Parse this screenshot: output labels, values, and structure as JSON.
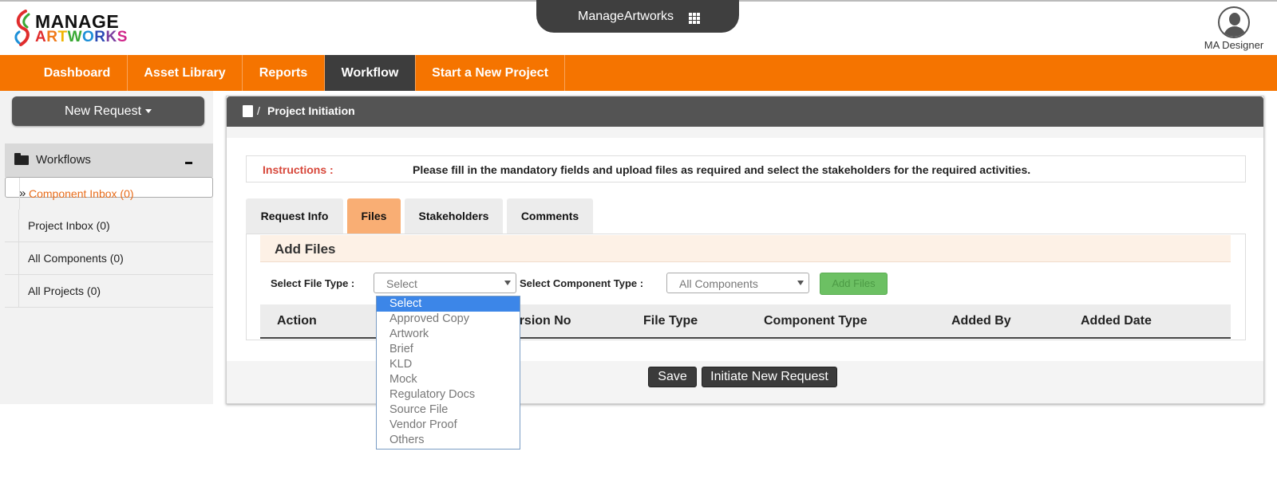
{
  "logo": {
    "line1": "MANAGE",
    "line2_letters": [
      "A",
      "R",
      "T",
      "W",
      "O",
      "R",
      "K",
      "S"
    ],
    "line2_colors": [
      "#e02d2d",
      "#f07a1a",
      "#f0b400",
      "#39a935",
      "#1c8fd8",
      "#2b4bb5",
      "#7b3fa0",
      "#d0288b"
    ]
  },
  "appbar": {
    "title": "ManageArtworks",
    "icon": "apps-grid-icon"
  },
  "user": {
    "name": "MA Designer",
    "icon": "user-avatar-icon"
  },
  "nav": {
    "items": [
      "Dashboard",
      "Asset Library",
      "Reports",
      "Workflow",
      "Start a New Project"
    ],
    "active": "Workflow"
  },
  "sidebar": {
    "new_request": "New Request",
    "workflows_label": "Workflows",
    "collapse_symbol": "-",
    "items": [
      {
        "label": "Component Inbox (0)",
        "selected": true,
        "marker": "»"
      },
      {
        "label": "Project Inbox (0)",
        "selected": false
      },
      {
        "label": "All Components (0)",
        "selected": false
      },
      {
        "label": "All Projects (0)",
        "selected": false
      }
    ]
  },
  "panel": {
    "breadcrumb_sep": "/",
    "title": "Project Initiation",
    "instructions_label": "Instructions :",
    "instructions_text": "Please fill in the mandatory fields and upload files as required and select the stakeholders for the required activities.",
    "tabs": [
      "Request Info",
      "Files",
      "Stakeholders",
      "Comments"
    ],
    "active_tab": "Files",
    "add_files_title": "Add Files",
    "file_type_label": "Select File Type :",
    "file_type_value": "Select",
    "component_type_label": "Select Component Type :",
    "component_type_value": "All Components",
    "add_files_button": "Add Files",
    "columns": [
      "Action",
      "Version No",
      "File Type",
      "Component Type",
      "Added By",
      "Added Date"
    ],
    "save_button": "Save",
    "initiate_button": "Initiate New Request"
  },
  "file_type_options": [
    "Select",
    "Approved Copy",
    "Artwork",
    "Brief",
    "KLD",
    "Mock",
    "Regulatory Docs",
    "Source File",
    "Vendor Proof",
    "Others"
  ],
  "colors": {
    "nav": "#f57400",
    "active_tab": "#f9ae74",
    "dark": "#545454",
    "highlight": "#3c86e8",
    "instructions": "#d7473a"
  }
}
